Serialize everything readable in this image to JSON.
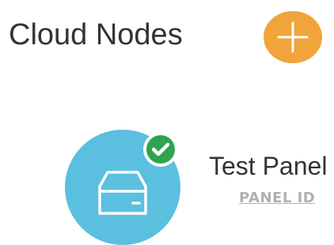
{
  "header": {
    "title": "Cloud Nodes",
    "add_icon": "plus-icon",
    "add_color": "#f0a43a"
  },
  "node": {
    "name": "Test Panel",
    "id_link": "PANEL ID",
    "icon": "server-icon",
    "status_icon": "check-icon",
    "status": "online",
    "avatar_color": "#5bbfe0",
    "status_color": "#2ea44f"
  }
}
